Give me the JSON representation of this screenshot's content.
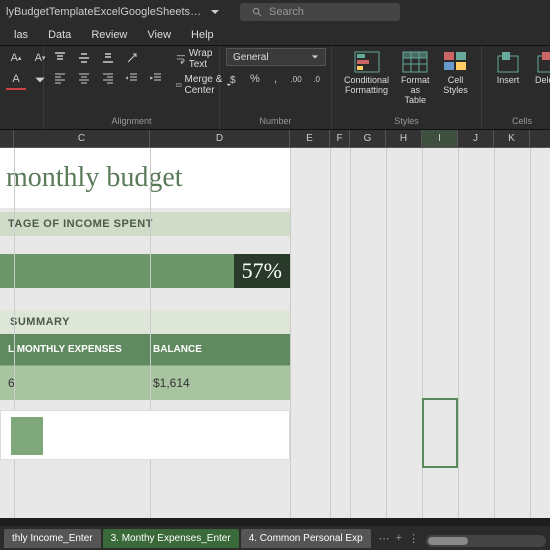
{
  "titlebar": {
    "filename": "lyBudgetTemplateExcelGoogleSheetsDownload EMB...",
    "search_placeholder": "Search"
  },
  "menubar": [
    "las",
    "Data",
    "Review",
    "View",
    "Help"
  ],
  "ribbon": {
    "wrap_text": "Wrap Text",
    "merge_center": "Merge & Center",
    "alignment_label": "Alignment",
    "number_format": "General",
    "number_label": "Number",
    "cond_fmt": "Conditional\nFormatting",
    "fmt_table": "Format as\nTable",
    "cell_styles": "Cell\nStyles",
    "styles_label": "Styles",
    "insert": "Insert",
    "delete": "Delete",
    "cells_label": "Cells"
  },
  "columns": [
    "",
    "C",
    "D",
    "E",
    "F",
    "G",
    "H",
    "I",
    "J",
    "K"
  ],
  "sheet": {
    "title": "monthly budget",
    "section1": "TAGE OF INCOME SPENT",
    "percent": "57%",
    "summary_hdr": "SUMMARY",
    "col1": "L MONTHLY EXPENSES",
    "col2": "BALANCE",
    "val1": "6",
    "val2": "$1,614"
  },
  "tabs": {
    "t1": "thly Income_Enter",
    "t2": "3. Monthy Expenses_Enter",
    "t3": "4. Common Personal Exp"
  }
}
